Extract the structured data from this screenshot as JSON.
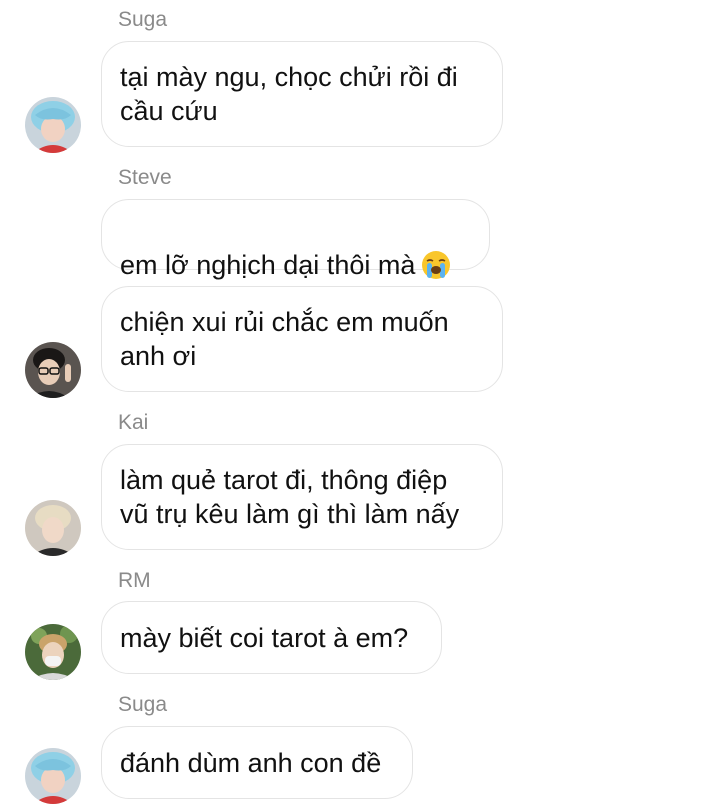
{
  "messages": [
    {
      "sender": "Suga",
      "text": "tại mày ngu, chọc chửi rồi đi\ncầu cứu",
      "avatar": "suga-avatar"
    },
    {
      "sender": "Steve",
      "text": "em lỡ nghịch dại thôi mà",
      "emoji": "😭"
    },
    {
      "sender": "",
      "text": "chiện xui rủi chắc em muốn\nanh ơi",
      "avatar": "steve-avatar"
    },
    {
      "sender": "Kai",
      "text": "làm quẻ tarot đi, thông điệp\nvũ trụ kêu làm gì thì làm nấy",
      "avatar": "kai-avatar"
    },
    {
      "sender": "RM",
      "text": "mày biết coi tarot à em?",
      "avatar": "rm-avatar"
    },
    {
      "sender": "Suga",
      "text": "đánh dùm anh con đề",
      "avatar": "suga-avatar"
    }
  ],
  "colors": {
    "bubble_border": "#e4e4e4",
    "sender_text": "#8a8a8a",
    "message_text": "#111111"
  }
}
